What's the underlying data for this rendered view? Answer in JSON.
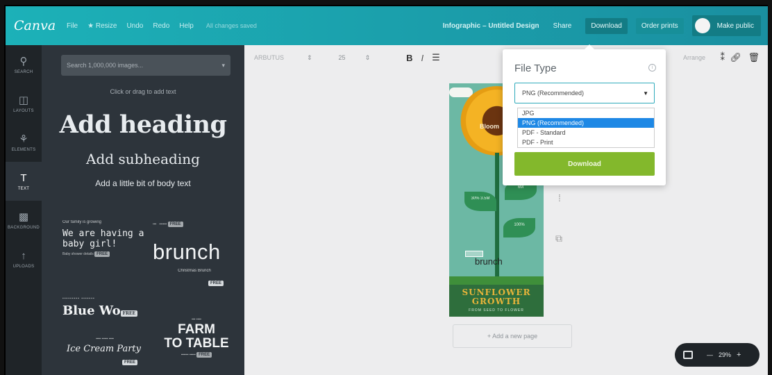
{
  "topbar": {
    "logo": "Canva",
    "menu": [
      "File",
      "★ Resize",
      "Undo",
      "Redo",
      "Help"
    ],
    "saved_status": "All changes saved",
    "doc_title": "Infographic – Untitled Design",
    "share": "Share",
    "download": "Download",
    "order_prints": "Order prints",
    "make_public": "Make public"
  },
  "rail": [
    {
      "icon": "search-icon",
      "glyph": "⚲",
      "label": "SEARCH"
    },
    {
      "icon": "layouts-icon",
      "glyph": "◫",
      "label": "LAYOUTS"
    },
    {
      "icon": "elements-icon",
      "glyph": "⚘",
      "label": "ELEMENTS"
    },
    {
      "icon": "text-icon",
      "glyph": "T",
      "label": "TEXT"
    },
    {
      "icon": "background-icon",
      "glyph": "▩",
      "label": "BACKGROUND"
    },
    {
      "icon": "uploads-icon",
      "glyph": "↑",
      "label": "UPLOADS"
    }
  ],
  "panel": {
    "search_placeholder": "Search 1,000,000 images...",
    "hint": "Click or drag to add text",
    "add_heading": "Add heading",
    "add_subheading": "Add subheading",
    "add_body": "Add a little bit of body text",
    "free_badge": "FREE",
    "templates": {
      "baby_small": "Our family is growing",
      "baby_main": "We are having a baby girl!",
      "baby_sub": "Baby shower details",
      "brunch": "brunch",
      "brunch_sub": "Christmas Brunch",
      "blue": "Blue Wo",
      "farm1": "FARM",
      "farm2": "TO TABLE",
      "icecream": "Ice Cream Party"
    }
  },
  "toolbar": {
    "font": "ARBUTUS",
    "size": "25",
    "bold": "B",
    "italic": "I",
    "arrange": "Arrange"
  },
  "design": {
    "bloom": "Bloom",
    "leaf1": "30% 3.5M",
    "leaf2": "6M",
    "leaf3": "100%",
    "title1": "SUNFLOWER",
    "title2": "GROWTH",
    "subtitle": "FROM SEED TO FLOWER",
    "brunch": "brunch"
  },
  "add_page": "+ Add a new page",
  "zoom": {
    "value": "29%"
  },
  "popover": {
    "title": "File Type",
    "selected": "PNG (Recommended)",
    "options": [
      "JPG",
      "PNG (Recommended)",
      "PDF - Standard",
      "PDF - Print"
    ],
    "download": "Download"
  }
}
